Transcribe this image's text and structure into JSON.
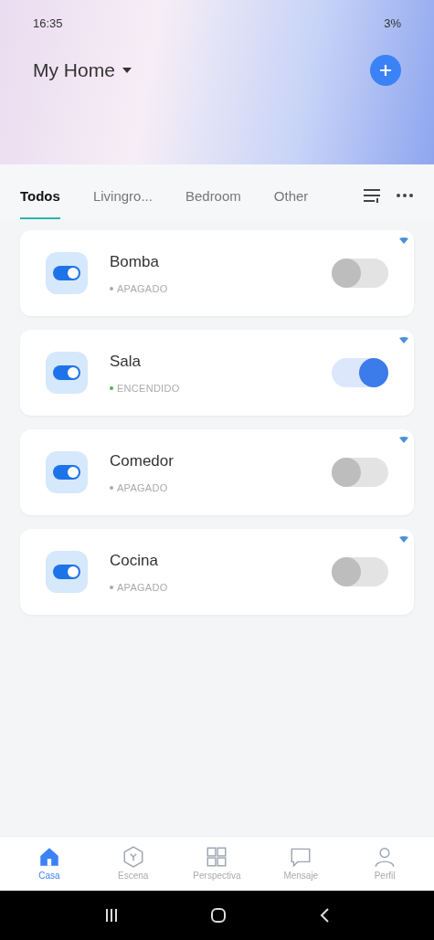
{
  "status_bar": {
    "time": "16:35",
    "battery": "3%"
  },
  "header": {
    "home_name": "My Home"
  },
  "tabs": [
    {
      "label": "Todos",
      "selected": true
    },
    {
      "label": "Livingro...",
      "selected": false
    },
    {
      "label": "Bedroom",
      "selected": false
    },
    {
      "label": "Other",
      "selected": false
    }
  ],
  "devices": [
    {
      "name": "Bomba",
      "status": "APAGADO",
      "on": false
    },
    {
      "name": "Sala",
      "status": "ENCENDIDO",
      "on": true
    },
    {
      "name": "Comedor",
      "status": "APAGADO",
      "on": false
    },
    {
      "name": "Cocina",
      "status": "APAGADO",
      "on": false
    }
  ],
  "bottom_nav": [
    {
      "label": "Casa",
      "selected": true,
      "kind": "home"
    },
    {
      "label": "Escena",
      "selected": false,
      "kind": "scene"
    },
    {
      "label": "Perspectiva",
      "selected": false,
      "kind": "grid"
    },
    {
      "label": "Mensaje",
      "selected": false,
      "kind": "message"
    },
    {
      "label": "Perfil",
      "selected": false,
      "kind": "profile"
    }
  ]
}
